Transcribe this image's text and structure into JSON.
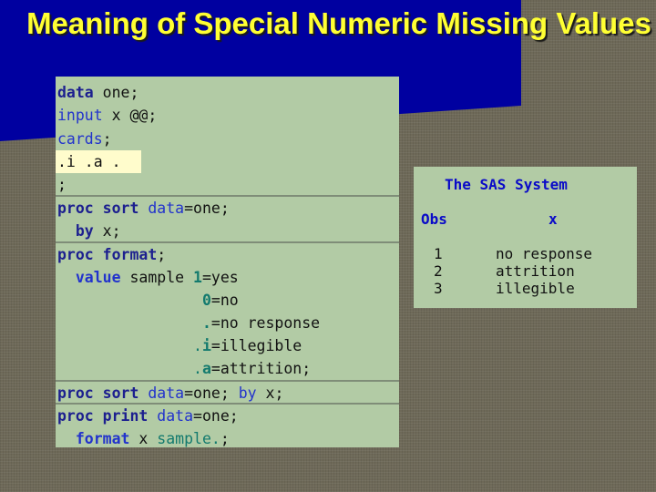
{
  "slide": {
    "title": "Meaning of Special Numeric Missing Values"
  },
  "code": {
    "lines": [
      {
        "parts": [
          "data",
          " one;"
        ]
      },
      {
        "parts": [
          "input",
          " x @@;"
        ]
      },
      {
        "parts": [
          "cards",
          ";"
        ]
      },
      {
        "parts": [
          ".i .a ."
        ]
      },
      {
        "parts": [
          ";"
        ]
      },
      {
        "parts": [
          "proc sort",
          " ",
          "data",
          "=one;"
        ]
      },
      {
        "parts": [
          "  ",
          "by",
          " x;"
        ]
      },
      {
        "parts": [
          "proc format",
          ";"
        ]
      },
      {
        "parts": [
          "  ",
          "value",
          " sample ",
          "1",
          "=yes"
        ]
      },
      {
        "parts": [
          "                ",
          "0",
          "=no"
        ]
      },
      {
        "parts": [
          "                ",
          ".",
          "=no response"
        ]
      },
      {
        "parts": [
          "               .",
          "i",
          "=illegible"
        ]
      },
      {
        "parts": [
          "               .",
          "a",
          "=attrition;"
        ]
      },
      {
        "parts": [
          "proc sort",
          " ",
          "data",
          "=one; ",
          "by",
          " x;"
        ]
      },
      {
        "parts": [
          "proc print",
          " ",
          "data",
          "=one;"
        ]
      },
      {
        "parts": [
          "  ",
          "format",
          " x ",
          "sample.",
          ";"
        ]
      }
    ]
  },
  "output": {
    "title": "The SAS System",
    "columns": [
      "Obs",
      "x"
    ],
    "rows": [
      {
        "obs": "1",
        "x": "no response"
      },
      {
        "obs": "2",
        "x": "attrition"
      },
      {
        "obs": "3",
        "x": "illegible"
      }
    ]
  },
  "colors": {
    "banner": "#0000a0",
    "title": "#ffff33",
    "panel": "#b2cba5",
    "highlight": "#fffccc",
    "keyword": "#1c1f8f",
    "format_value": "#137a6e"
  }
}
